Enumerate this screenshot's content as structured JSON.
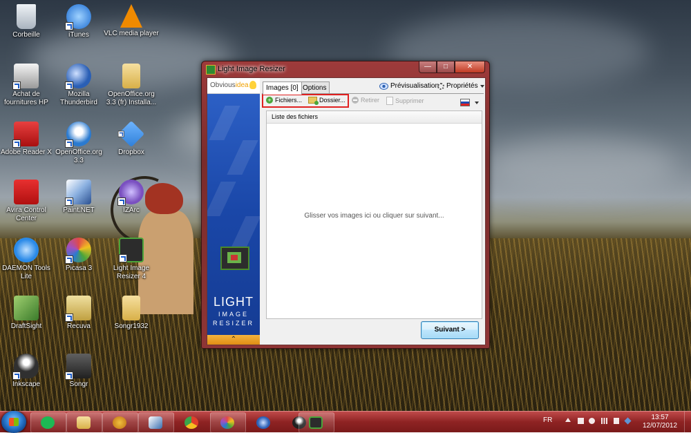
{
  "desktop": {
    "icons": [
      {
        "label": "Corbeille",
        "icon": "recycle-bin-icon",
        "color": "#cfd8e0"
      },
      {
        "label": "iTunes",
        "icon": "itunes-icon",
        "color": "#2a7ee0"
      },
      {
        "label": "VLC media player",
        "icon": "vlc-icon",
        "color": "#f08a00"
      },
      {
        "label": "Achat de fournitures HP",
        "icon": "printer-icon",
        "color": "#e0e0e0"
      },
      {
        "label": "Mozilla Thunderbird",
        "icon": "thunderbird-icon",
        "color": "#2a5fb5"
      },
      {
        "label": "OpenOffice.org 3.3 (fr) Installa...",
        "icon": "folder-icon",
        "color": "#e8c860"
      },
      {
        "label": "Adobe Reader X",
        "icon": "adobe-reader-icon",
        "color": "#c81a1a"
      },
      {
        "label": "OpenOffice.org 3.3",
        "icon": "openoffice-icon",
        "color": "#2a7ad0"
      },
      {
        "label": "Dropbox",
        "icon": "dropbox-icon",
        "color": "#3a90e0"
      },
      {
        "label": "Avira Control Center",
        "icon": "avira-icon",
        "color": "#d01818"
      },
      {
        "label": "Paint.NET",
        "icon": "paintnet-icon",
        "color": "#3a6fb0"
      },
      {
        "label": "IZArc",
        "icon": "izarc-icon",
        "color": "#8a60c8"
      },
      {
        "label": "DAEMON Tools Lite",
        "icon": "daemon-tools-icon",
        "color": "#2a8ae8"
      },
      {
        "label": "Picasa 3",
        "icon": "picasa-icon",
        "color": "#e04a8a"
      },
      {
        "label": "Light Image Resizer 4",
        "icon": "light-image-resizer-icon",
        "color": "#4aa53a"
      },
      {
        "label": "DraftSight",
        "icon": "draftsight-icon",
        "color": "#6aa040"
      },
      {
        "label": "Recuva",
        "icon": "recuva-icon",
        "color": "#d8c060"
      },
      {
        "label": "Songr1932",
        "icon": "folder-icon",
        "color": "#e8c860"
      },
      {
        "label": "Inkscape",
        "icon": "inkscape-icon",
        "color": "#202020"
      },
      {
        "label": "Songr",
        "icon": "songr-icon",
        "color": "#404040"
      }
    ]
  },
  "window": {
    "title": "Light Image Resizer",
    "minimize": "—",
    "maximize": "□",
    "close": "✕",
    "sidebar": {
      "logo_part1": "Obvious",
      "logo_part2": "idea",
      "brand_line1": "LIGHT",
      "brand_line2": "IMAGE",
      "brand_line3": "RESIZER",
      "collapse": "⌃"
    },
    "tabs": [
      {
        "label": "Images [0]",
        "active": true
      },
      {
        "label": "Options",
        "active": false
      }
    ],
    "preview_label": "Prévisualisation",
    "properties_label": "Propriétés",
    "toolbar": {
      "files": "Fichiers...",
      "folder": "Dossier...",
      "remove": "Retirer",
      "delete": "Supprimer"
    },
    "list_header": "Liste des fichiers",
    "empty_hint": "Glisser vos images ici ou cliquer sur suivant...",
    "next_button": "Suivant >"
  },
  "taskbar": {
    "apps": [
      {
        "name": "spotify-icon",
        "color": "#1db954"
      },
      {
        "name": "explorer-icon",
        "color": "#e8c860"
      },
      {
        "name": "songr-icon",
        "color": "#e0a020"
      },
      {
        "name": "paintnet-icon",
        "color": "#3a6fb0"
      },
      {
        "name": "chrome-icon",
        "color": "#e0402a"
      },
      {
        "name": "picasa-icon",
        "color": "#e04a8a"
      },
      {
        "name": "thunderbird-icon",
        "color": "#2a5fb5"
      },
      {
        "name": "inkscape-icon",
        "color": "#202020"
      },
      {
        "name": "light-image-resizer-icon",
        "color": "#4aa53a"
      }
    ],
    "language": "FR",
    "time": "13:57",
    "date": "12/07/2012"
  }
}
